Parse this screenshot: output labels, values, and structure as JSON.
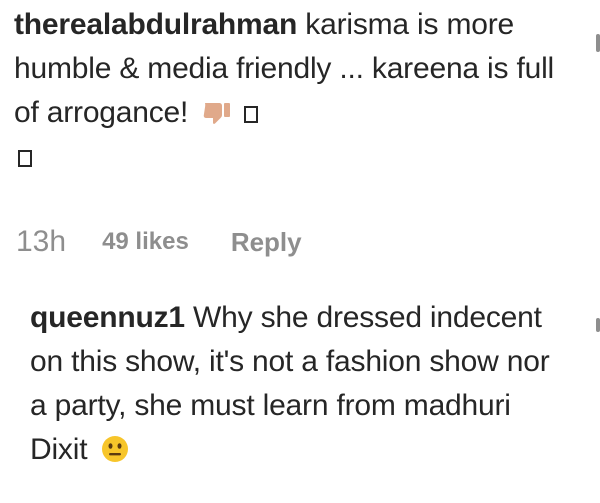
{
  "comments": [
    {
      "username": "therealabdulrahman",
      "text": "karisma is more humble & media friendly ... kareena is full of arrogance!",
      "emoji": "thumbs-down-icon",
      "time": "13h",
      "likes": "49 likes",
      "reply_label": "Reply"
    },
    {
      "username": "queennuz1",
      "text": "Why she dressed indecent on this show, it's not a fashion show nor a party, she must learn from madhuri Dixit",
      "emoji": "neutral-face-icon"
    }
  ],
  "colors": {
    "text": "#262626",
    "meta": "#8e8e8e",
    "emoji_skin": "#e0a98a",
    "emoji_face": "#f7c52a"
  }
}
